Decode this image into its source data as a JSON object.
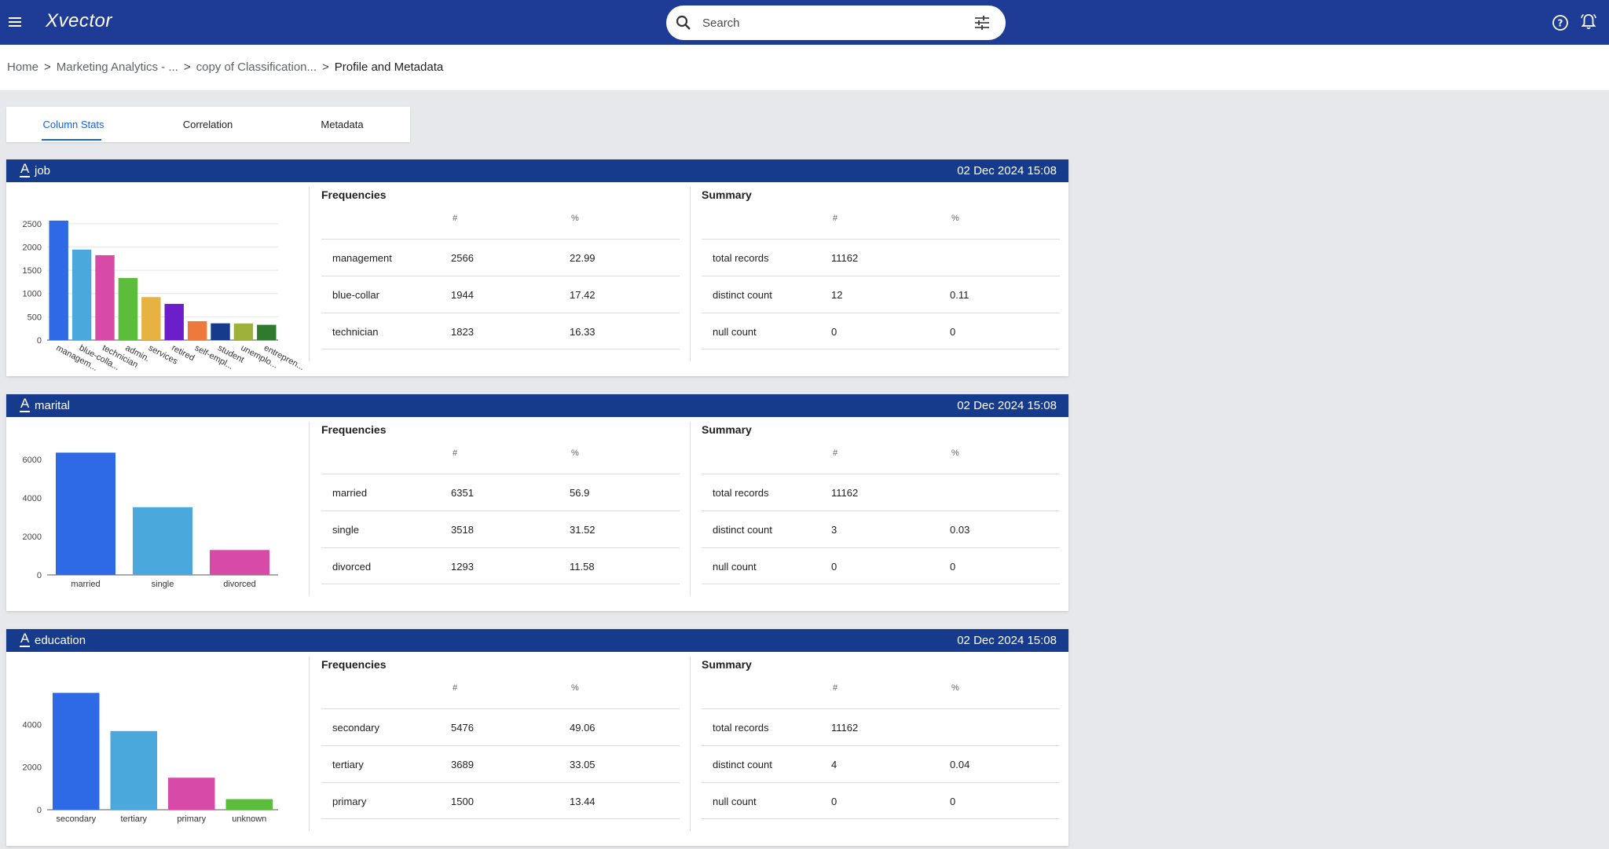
{
  "app": {
    "logo": "Xvector"
  },
  "topbar": {
    "menu_icon": "menu-icon",
    "search_placeholder": "Search",
    "search_icon": "search-icon",
    "filter_icon": "tune-icon",
    "help_icon": "help-circle-icon",
    "notifications_icon": "bell-icon",
    "header_color": "#1e3c96"
  },
  "breadcrumb": {
    "items": [
      "Home",
      "Marketing Analytics - ...",
      "copy of Classification...",
      "Profile and Metadata"
    ],
    "separator": ">"
  },
  "tabs": [
    {
      "label": "Column Stats",
      "active": true
    },
    {
      "label": "Correlation",
      "active": false
    },
    {
      "label": "Metadata",
      "active": false
    }
  ],
  "accent_color": "#1a63e0",
  "columns": [
    {
      "type_icon": "A",
      "name": "job",
      "timestamp": "02 Dec 2024 15:08",
      "frequencies": {
        "title": "Frequencies",
        "headers": [
          "#",
          "%"
        ],
        "rows": [
          {
            "label": "management",
            "count": "2566",
            "pct": "22.99"
          },
          {
            "label": "blue-collar",
            "count": "1944",
            "pct": "17.42"
          },
          {
            "label": "technician",
            "count": "1823",
            "pct": "16.33"
          }
        ]
      },
      "summary": {
        "title": "Summary",
        "headers": [
          "#",
          "%"
        ],
        "rows": [
          {
            "label": "total records",
            "count": "11162",
            "pct": ""
          },
          {
            "label": "distinct count",
            "count": "12",
            "pct": "0.11"
          },
          {
            "label": "null count",
            "count": "0",
            "pct": "0"
          }
        ]
      }
    },
    {
      "type_icon": "A",
      "name": "marital",
      "timestamp": "02 Dec 2024 15:08",
      "frequencies": {
        "title": "Frequencies",
        "headers": [
          "#",
          "%"
        ],
        "rows": [
          {
            "label": "married",
            "count": "6351",
            "pct": "56.9"
          },
          {
            "label": "single",
            "count": "3518",
            "pct": "31.52"
          },
          {
            "label": "divorced",
            "count": "1293",
            "pct": "11.58"
          }
        ]
      },
      "summary": {
        "title": "Summary",
        "headers": [
          "#",
          "%"
        ],
        "rows": [
          {
            "label": "total records",
            "count": "11162",
            "pct": ""
          },
          {
            "label": "distinct count",
            "count": "3",
            "pct": "0.03"
          },
          {
            "label": "null count",
            "count": "0",
            "pct": "0"
          }
        ]
      }
    },
    {
      "type_icon": "A",
      "name": "education",
      "timestamp": "02 Dec 2024 15:08",
      "frequencies": {
        "title": "Frequencies",
        "headers": [
          "#",
          "%"
        ],
        "rows": [
          {
            "label": "secondary",
            "count": "5476",
            "pct": "49.06"
          },
          {
            "label": "tertiary",
            "count": "3689",
            "pct": "33.05"
          },
          {
            "label": "primary",
            "count": "1500",
            "pct": "13.44"
          }
        ]
      },
      "summary": {
        "title": "Summary",
        "headers": [
          "#",
          "%"
        ],
        "rows": [
          {
            "label": "total records",
            "count": "11162",
            "pct": ""
          },
          {
            "label": "distinct count",
            "count": "4",
            "pct": "0.04"
          },
          {
            "label": "null count",
            "count": "0",
            "pct": "0"
          }
        ]
      }
    }
  ],
  "chart_data": [
    {
      "type": "bar",
      "categories": [
        "managem...",
        "blue-colla...",
        "technician",
        "admin.",
        "services",
        "retired",
        "self-empl...",
        "student",
        "unemplo...",
        "entrepren..."
      ],
      "values": [
        2566,
        1944,
        1823,
        1334,
        923,
        778,
        405,
        360,
        357,
        328
      ],
      "colors": [
        "#2f6ae6",
        "#4aa8dc",
        "#d84aa7",
        "#5cbc3c",
        "#e8b243",
        "#6b1ec9",
        "#ed7a3c",
        "#173b8c",
        "#9eb23b",
        "#2f7a2f"
      ],
      "yticks": [
        0,
        500,
        1000,
        1500,
        2000,
        2500
      ],
      "ylim": [
        0,
        2750
      ],
      "rotated_labels": true,
      "grid": true
    },
    {
      "type": "bar",
      "categories": [
        "married",
        "single",
        "divorced"
      ],
      "values": [
        6351,
        3518,
        1293
      ],
      "colors": [
        "#2f6ae6",
        "#4aa8dc",
        "#d84aa7"
      ],
      "yticks": [
        0,
        2000,
        4000,
        6000
      ],
      "ylim": [
        0,
        6650
      ],
      "rotated_labels": false,
      "grid": false
    },
    {
      "type": "bar",
      "categories": [
        "secondary",
        "tertiary",
        "primary",
        "unknown"
      ],
      "values": [
        5476,
        3689,
        1500,
        497
      ],
      "colors": [
        "#2f6ae6",
        "#4aa8dc",
        "#d84aa7",
        "#5cbc3c"
      ],
      "yticks": [
        0,
        2000,
        4000
      ],
      "ylim": [
        0,
        6000
      ],
      "rotated_labels": false,
      "grid": false
    }
  ]
}
